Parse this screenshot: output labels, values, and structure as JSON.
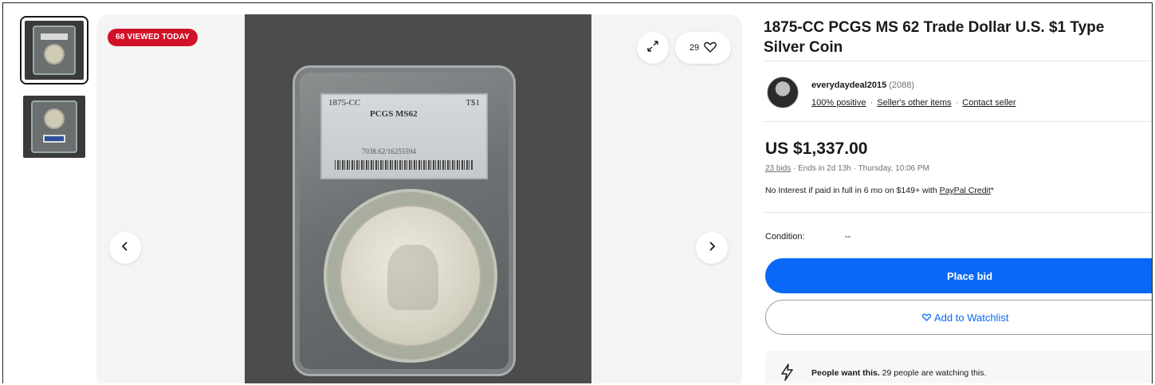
{
  "thumbnails": [
    {
      "label": "thumbnail-1"
    },
    {
      "label": "thumbnail-2"
    }
  ],
  "gallery": {
    "viewed_badge": "68 VIEWED TODAY",
    "watch_count": "29",
    "slab_label": {
      "year": "1875-CC",
      "denomination": "T$1",
      "grade": "PCGS MS62",
      "cert": "7038.62/16255594"
    }
  },
  "listing": {
    "title": "1875-CC PCGS MS 62 Trade Dollar U.S. $1 Type Silver Coin",
    "seller": {
      "name": "everydaydeal2015",
      "feedback_count": "(2088)",
      "positive": "100% positive",
      "other_items": "Seller's other items",
      "contact": "Contact seller",
      "sep": "·"
    },
    "price": "US $1,337.00",
    "bids": "23 bids",
    "ends": "· Ends in 2d 13h · Thursday, 10:06 PM",
    "interest_prefix": "No Interest if paid in full in 6 mo on $149+ with ",
    "interest_link": "PayPal Credit",
    "interest_suffix": "*",
    "condition_label": "Condition:",
    "condition_value": "--",
    "place_bid": "Place bid",
    "add_watchlist": "Add to Watchlist",
    "people_bold": "People want this.",
    "people_rest": " 29 people are watching this."
  }
}
